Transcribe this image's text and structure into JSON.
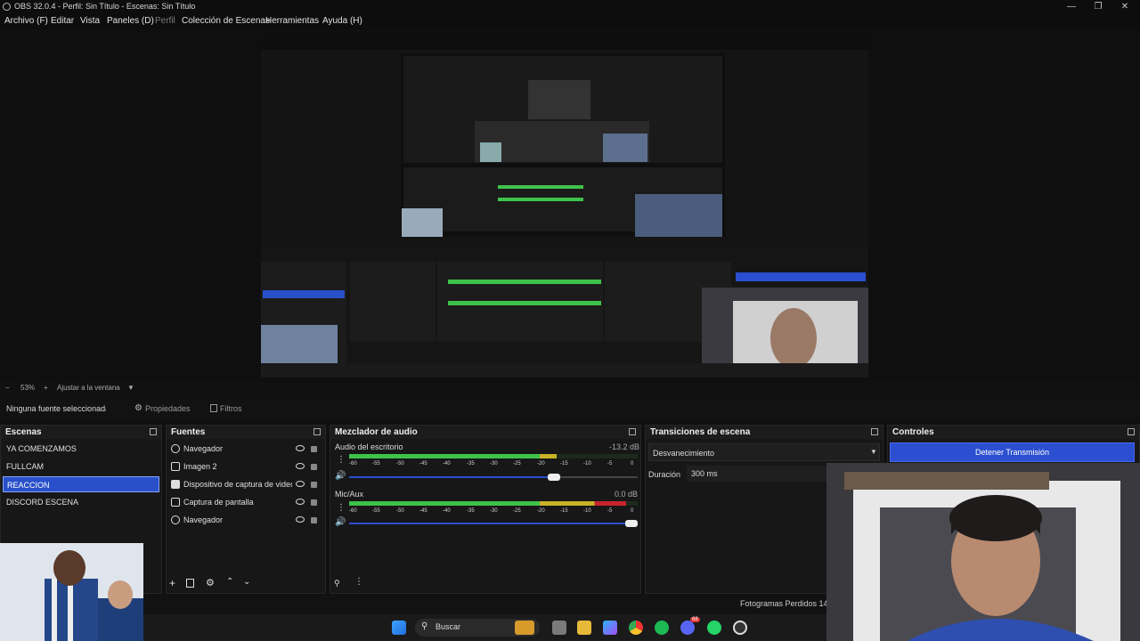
{
  "window": {
    "title": "OBS 32.0.4 - Perfil: Sin Título - Escenas: Sin Título",
    "controls": [
      "—",
      "❐",
      "✕"
    ]
  },
  "menu": [
    {
      "label": "Archivo (F)",
      "disabled": false
    },
    {
      "label": "Editar",
      "disabled": false
    },
    {
      "label": "Vista",
      "disabled": false
    },
    {
      "label": "Paneles (D)",
      "disabled": false
    },
    {
      "label": "Perfil",
      "disabled": true
    },
    {
      "label": "Colección de Escenas",
      "disabled": false
    },
    {
      "label": "Herramientas",
      "disabled": false
    },
    {
      "label": "Ayuda (H)",
      "disabled": false
    }
  ],
  "zoom": {
    "minus": "−",
    "value": "53%",
    "plus": "+",
    "fit_label": "Ajustar a la ventana"
  },
  "properties_bar": {
    "no_source": "Ninguna fuente seleccionada",
    "properties_label": "Propiedades",
    "filters_label": "Filtros"
  },
  "scenes": {
    "title": "Escenas",
    "items": [
      {
        "label": "YA COMENZAMOS",
        "selected": false
      },
      {
        "label": "FULLCAM",
        "selected": false
      },
      {
        "label": "REACCION",
        "selected": true
      },
      {
        "label": "DISCORD ESCENA",
        "selected": false
      }
    ]
  },
  "sources": {
    "title": "Fuentes",
    "items": [
      {
        "label": "Navegador",
        "icon": "globe-icon"
      },
      {
        "label": "Imagen 2",
        "icon": "image-icon"
      },
      {
        "label": "Dispositivo de captura de video",
        "icon": "camera-icon"
      },
      {
        "label": "Captura de pantalla",
        "icon": "monitor-icon"
      },
      {
        "label": "Navegador",
        "icon": "globe-icon"
      }
    ]
  },
  "mixer": {
    "title": "Mezclador de audio",
    "channels": [
      {
        "name": "Audio del escritorio",
        "db": "-13.2 dB",
        "level": 0.72,
        "volume": 0.73
      },
      {
        "name": "Mic/Aux",
        "db": "0.0 dB",
        "level": 0.96,
        "volume": 1.0
      }
    ],
    "ticks": [
      "-60",
      "-55",
      "-50",
      "-45",
      "-40",
      "-35",
      "-30",
      "-25",
      "-20",
      "-15",
      "-10",
      "-5",
      "0"
    ]
  },
  "transitions": {
    "title": "Transiciones de escena",
    "selected": "Desvanecimiento",
    "duration_label": "Duración",
    "duration_value": "300 ms"
  },
  "controls": {
    "title": "Controles",
    "stop_stream": "Detener Transmisión"
  },
  "status": {
    "dropped_frames": "Fotogramas Perdidos 14"
  },
  "taskbar": {
    "search": "Buscar",
    "icons": [
      "windows-start-icon",
      "search-icon",
      "widget-icon",
      "task-view-icon",
      "file-explorer-icon",
      "copilot-icon",
      "chrome-icon",
      "spotify-icon",
      "discord-icon",
      "whatsapp-icon",
      "obs-icon"
    ],
    "discord_badge": "68"
  },
  "colors": {
    "accent": "#2950c8",
    "meter_green": "#3ec24a",
    "meter_yellow": "#c8b426",
    "meter_red": "#c8242c"
  }
}
